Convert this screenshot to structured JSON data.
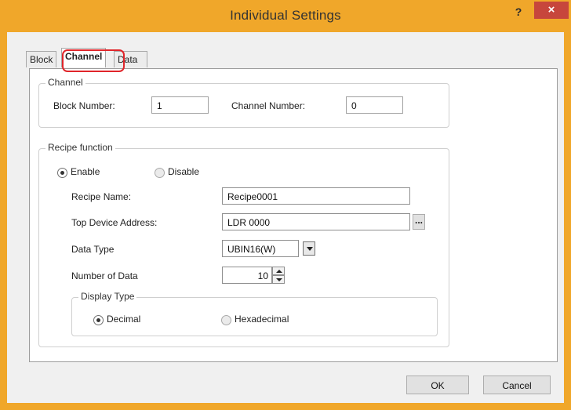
{
  "dialog": {
    "title": "Individual Settings",
    "help_label": "?",
    "close_label": "×"
  },
  "tabs": [
    {
      "label": "Block"
    },
    {
      "label": "Channel"
    },
    {
      "label": "Data"
    }
  ],
  "channel_group": {
    "legend": "Channel",
    "block_number_label": "Block Number:",
    "block_number_value": "1",
    "channel_number_label": "Channel Number:",
    "channel_number_value": "0"
  },
  "recipe_group": {
    "legend": "Recipe function",
    "enable_label": "Enable",
    "disable_label": "Disable",
    "enable_selected": true,
    "recipe_name_label": "Recipe Name:",
    "recipe_name_value": "Recipe0001",
    "top_device_label": "Top Device Address:",
    "top_device_value": "LDR 0000",
    "browse_label": "...",
    "data_type_label": "Data Type",
    "data_type_value": "UBIN16(W)",
    "number_of_data_label": "Number of Data",
    "number_of_data_value": "10"
  },
  "display_type_group": {
    "legend": "Display Type",
    "decimal_label": "Decimal",
    "hexadecimal_label": "Hexadecimal",
    "selected": "Decimal"
  },
  "buttons": {
    "ok_label": "OK",
    "cancel_label": "Cancel"
  },
  "colors": {
    "titlebar": "#f0a72a",
    "close_button": "#c7463c",
    "tab_highlight": "#e0252a"
  }
}
